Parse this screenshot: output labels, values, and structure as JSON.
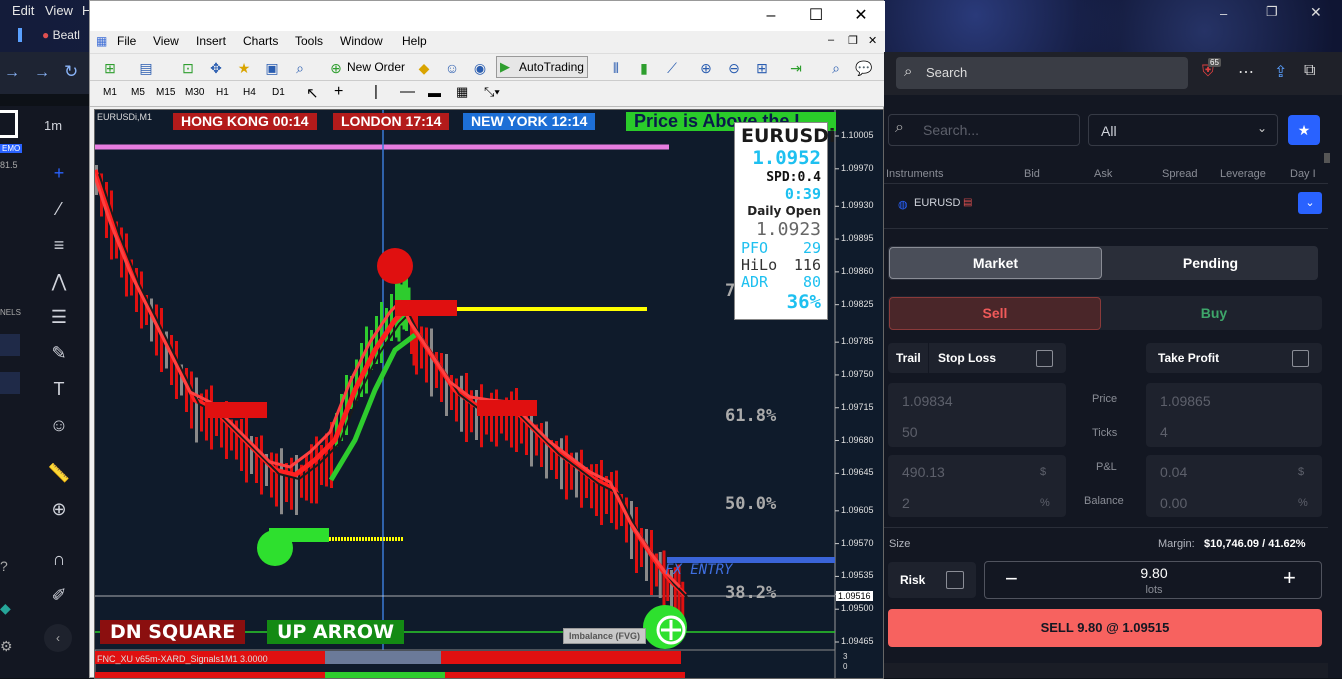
{
  "desktop": {
    "menu": [
      "Edit",
      "View",
      "H"
    ],
    "taskbar_label": "Beatl"
  },
  "tradingview": {
    "timeframe": "1m",
    "demo_badge": "EMO",
    "price_small": "81.5",
    "panels_label": "NELS"
  },
  "mt4": {
    "menu": [
      "File",
      "View",
      "Insert",
      "Charts",
      "Tools",
      "Window",
      "Help"
    ],
    "toolbar": {
      "new_order": "New Order",
      "autotrading": "AutoTrading"
    },
    "timeframes": [
      "M1",
      "M5",
      "M15",
      "M30",
      "H1",
      "H4",
      "D1"
    ],
    "chart": {
      "symbol_label": "EURUSDi,M1",
      "sessions": [
        {
          "name": "HONG KONG 00:14",
          "color": "#b31b1b"
        },
        {
          "name": "LONDON   17:14",
          "color": "#b31b1b"
        },
        {
          "name": "NEW YORK  12:14",
          "color": "#1d6fd6"
        }
      ],
      "banner": "Price is Above the I",
      "info": {
        "symbol": "EURUSDi",
        "price": "1.0952",
        "spread": "SPD:0.4",
        "timer": "0:39",
        "daily_open_label": "Daily Open",
        "daily_open": "1.0923",
        "pfo_label": "PFO",
        "pfo": "29",
        "hilo_label": "HiLo",
        "hilo": "116",
        "adr_label": "ADR",
        "adr": "80",
        "pct": "36%"
      },
      "fib_levels": [
        {
          "label": "7",
          "price": 1.09816
        },
        {
          "label": "61.8%",
          "price": 1.09704
        },
        {
          "label": "50.0%",
          "price": 1.09613
        },
        {
          "label": "38.2%",
          "price": 1.09522
        }
      ],
      "price_axis": [
        "1.10005",
        "1.09970",
        "1.09930",
        "1.09895",
        "1.09860",
        "1.09825",
        "1.09785",
        "1.09750",
        "1.09715",
        "1.09680",
        "1.09645",
        "1.09605",
        "1.09570",
        "1.09535",
        "1.09516",
        "1.09500",
        "1.09465"
      ],
      "current_price": "1.09516",
      "entry_label": "FX ENTRY",
      "dn_square": "DN SQUARE",
      "up_arrow": "UP ARROW",
      "imbalance": "Imbalance (FVG)",
      "indicator_label": "FNC_XU v65m-XARD_Signals1M1 3.0000",
      "sub_axis": [
        "3",
        "0"
      ]
    }
  },
  "browser": {
    "search_placeholder": "Search",
    "badge": "65"
  },
  "panel": {
    "search_placeholder": "Search...",
    "filter": "All",
    "columns": [
      "Instruments",
      "Bid",
      "Ask",
      "Spread",
      "Leverage",
      "Day I"
    ],
    "symbol": "EURUSD",
    "order_types": [
      "Market",
      "Pending"
    ],
    "sides": [
      "Sell",
      "Buy"
    ],
    "trail": "Trail",
    "stop_loss": "Stop Loss",
    "take_profit": "Take Profit",
    "sl": {
      "price": "1.09834",
      "ticks": "50",
      "pnl": "490.13",
      "pct": "2"
    },
    "tp": {
      "price": "1.09865",
      "ticks": "4",
      "pnl": "0.04",
      "pct": "0.00"
    },
    "mid_labels": {
      "price": "Price",
      "ticks": "Ticks",
      "pnl": "P&L",
      "balance": "Balance"
    },
    "units": {
      "usd": "$",
      "pct": "%"
    },
    "size_label": "Size",
    "margin_label": "Margin:",
    "margin_value": "$10,746.09 / 41.62%",
    "risk_label": "Risk",
    "lots_value": "9.80",
    "lots_label": "lots",
    "submit": "SELL 9.80 @ 1.09515"
  }
}
